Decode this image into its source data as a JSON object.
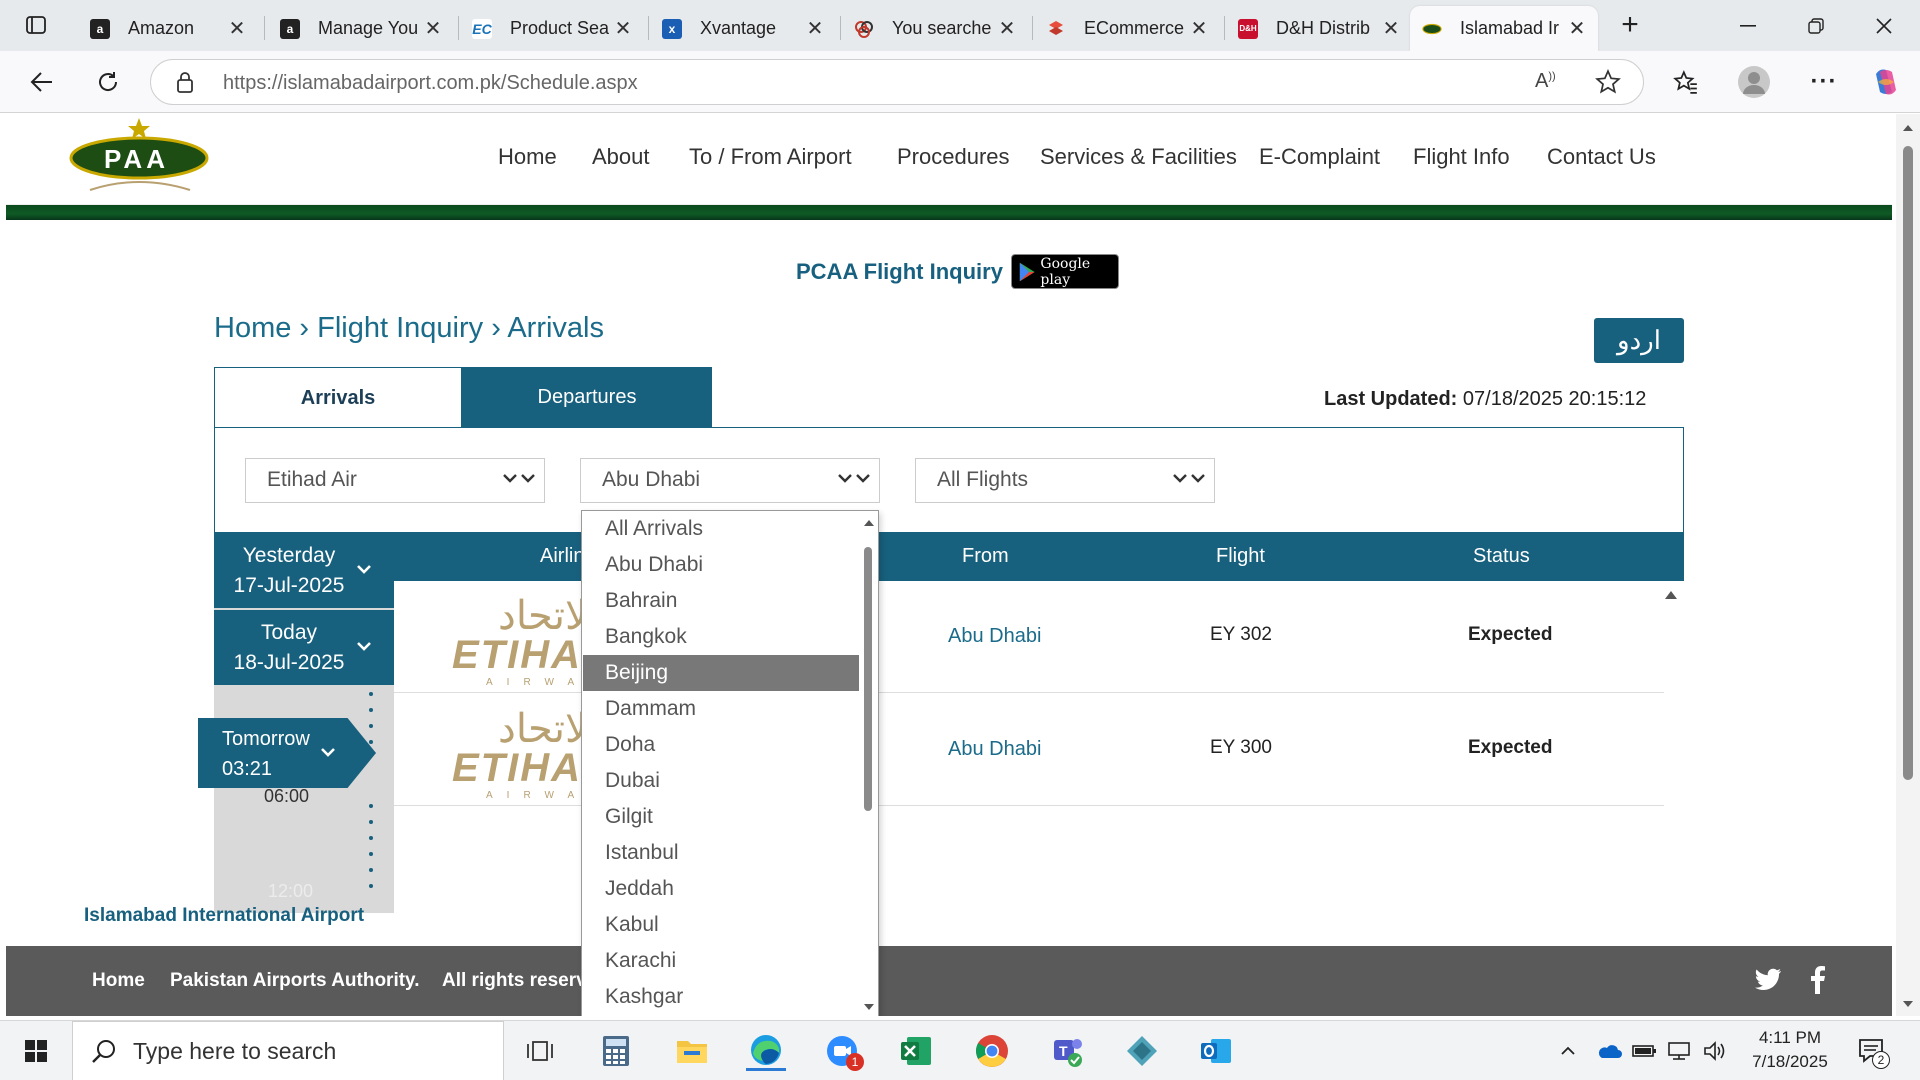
{
  "browser": {
    "tabs": [
      {
        "title": "Amazon",
        "favicon": "amazon-icon"
      },
      {
        "title": "Manage You",
        "favicon": "amazon-icon"
      },
      {
        "title": "Product Sea",
        "favicon": "ec-icon"
      },
      {
        "title": "Xvantage",
        "favicon": "xvantage-icon"
      },
      {
        "title": "You searche",
        "favicon": "search-results-icon"
      },
      {
        "title": "ECommerce",
        "favicon": "ecommerce-icon"
      },
      {
        "title": "D&H Distrib",
        "favicon": "dh-icon"
      },
      {
        "title": "Islamabad Ir",
        "favicon": "paa-icon"
      }
    ],
    "url_host": "https://islamabadairport.com.pk",
    "url_path": "/Schedule.aspx"
  },
  "site": {
    "logo_text": "PAA",
    "nav": [
      "Home",
      "About",
      "To / From Airport",
      "Procedures",
      "Services & Facilities",
      "E-Complaint",
      "Flight Info",
      "Contact Us"
    ],
    "inquiry_label": "PCAA Flight Inquiry",
    "google_play": "Google play",
    "breadcrumb": "Home › Flight Inquiry › Arrivals",
    "urdu_button": "اردو",
    "tabs": {
      "arrivals": "Arrivals",
      "departures": "Departures"
    },
    "last_updated_label": "Last Updated:",
    "last_updated_value": "07/18/2025 20:15:12"
  },
  "filters": {
    "airline": "Etihad Air",
    "city": "Abu Dhabi",
    "flights": "All Flights"
  },
  "dropdown": {
    "options": [
      "All Arrivals",
      "Abu Dhabi",
      "Bahrain",
      "Bangkok",
      "Beijing",
      "Dammam",
      "Doha",
      "Dubai",
      "Gilgit",
      "Istanbul",
      "Jeddah",
      "Kabul",
      "Karachi",
      "Kashgar"
    ],
    "highlighted": "Beijing"
  },
  "dates": {
    "yesterday": {
      "label": "Yesterday",
      "date": "17-Jul-2025"
    },
    "today": {
      "label": "Today",
      "date": "18-Jul-2025"
    },
    "tomorrow": {
      "label": "Tomorrow",
      "time": "03:21"
    },
    "time_marks": [
      "06:00",
      "12:00"
    ]
  },
  "table": {
    "columns": [
      "Airline",
      "From",
      "Flight",
      "Status"
    ],
    "rows": [
      {
        "airline_logo": "etihad-airways-logo",
        "from": "Abu Dhabi",
        "flight": "EY 302",
        "status": "Expected"
      },
      {
        "airline_logo": "etihad-airways-logo",
        "from": "Abu Dhabi",
        "flight": "EY 300",
        "status": "Expected"
      }
    ]
  },
  "etihad_logo": {
    "arabic": "الاتحاد",
    "name": "ETIHAD",
    "sub": "AIRWAYS"
  },
  "footer": {
    "airport_name": "Islamabad International Airport",
    "home": "Home",
    "authority": "Pakistan Airports Authority.",
    "rights": "All rights reserved"
  },
  "taskbar": {
    "search_placeholder": "Type here to search",
    "time": "4:11 PM",
    "date": "7/18/2025",
    "notification_count": "2",
    "zoom_badge": "1"
  },
  "colors": {
    "brand_teal": "#17607e",
    "brand_green": "#0f5a25",
    "etihad_gold": "#b8a071",
    "footer_gray": "#5a5a5a"
  }
}
